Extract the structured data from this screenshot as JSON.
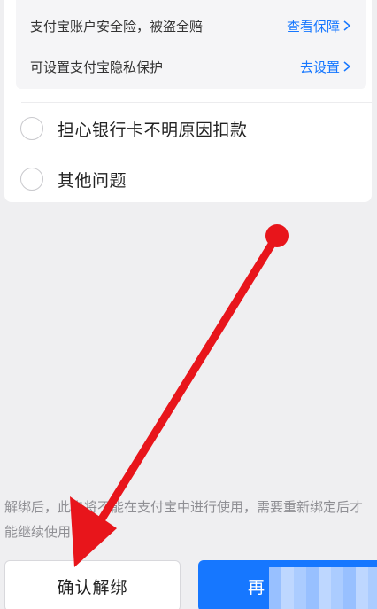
{
  "info_box": {
    "row1": {
      "text": "支付宝账户安全险，被盗全赔",
      "link": "查看保障"
    },
    "row2": {
      "text": "可设置支付宝隐私保护",
      "link": "去设置"
    }
  },
  "options": [
    {
      "label": "担心银行卡不明原因扣款"
    },
    {
      "label": "其他问题"
    }
  ],
  "notice": "解绑后，此卡将不能在支付宝中进行使用，需要重新绑定后才能继续使用",
  "buttons": {
    "confirm_unbind": "确认解绑",
    "primary": "再"
  },
  "colors": {
    "accent": "#1677ff",
    "annotation_arrow": "#e8151b"
  },
  "icons": [
    "chevron-right-icon",
    "radio-unchecked-icon",
    "annotation-arrow"
  ]
}
